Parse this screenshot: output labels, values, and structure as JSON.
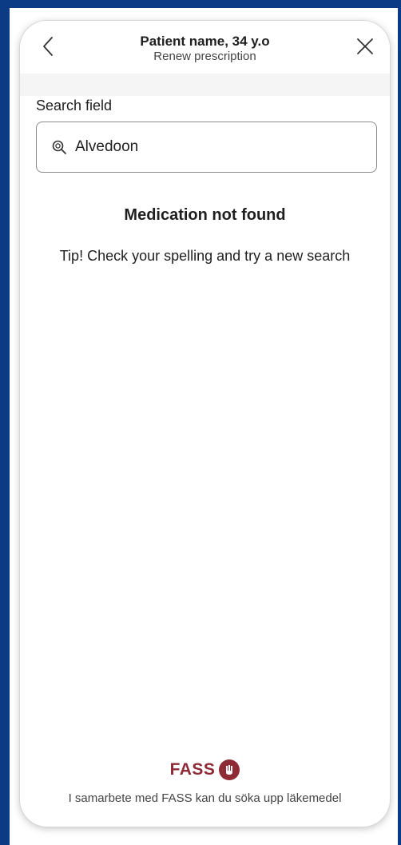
{
  "header": {
    "title": "Patient name, 34 y.o",
    "subtitle": "Renew prescription",
    "back_icon": "chevron-left-icon",
    "close_icon": "close-icon"
  },
  "search": {
    "label": "Search field",
    "value": "Alvedoon",
    "icon": "search-icon"
  },
  "empty_state": {
    "title": "Medication not found",
    "tip": "Tip! Check your spelling and try a new search"
  },
  "footer": {
    "logo_text": "FASS",
    "partner_text": "I samarbete med FASS kan du söka upp läkemedel"
  },
  "colors": {
    "frame": "#0b3b84",
    "fass_brand": "#8e2a36",
    "text": "#1f1f1f"
  }
}
